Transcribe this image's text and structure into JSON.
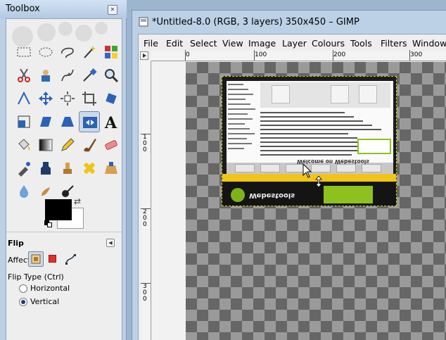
{
  "toolbox": {
    "title": "Toolbox",
    "close_icon": "close-icon",
    "tools": [
      "rect-select-icon",
      "ellipse-select-icon",
      "lasso-icon",
      "fuzzy-select-icon",
      "select-by-color-icon",
      "scissors-icon",
      "foreground-select-icon",
      "paths-icon",
      "color-picker-icon",
      "magnify-icon",
      "measure-icon",
      "move-icon",
      "align-icon",
      "crop-icon",
      "rotate-icon",
      "scale-icon",
      "shear-icon",
      "perspective-icon",
      "flip-icon",
      "text-icon",
      "bucket-fill-icon",
      "blend-icon",
      "pencil-icon",
      "paintbrush-icon",
      "eraser-icon",
      "airbrush-icon",
      "ink-icon",
      "clone-icon",
      "heal-icon",
      "perspective-clone-icon",
      "blur-icon",
      "smudge-icon",
      "dodge-burn-icon"
    ],
    "active_tool": "flip-icon",
    "fg_color": "#000000",
    "bg_color": "#ffffff"
  },
  "tool_options": {
    "title": "Flip",
    "affect_label": "Affect:",
    "flip_type_label": "Flip Type  (Ctrl)",
    "options": [
      "Horizontal",
      "Vertical"
    ],
    "selected": "Vertical"
  },
  "image_window": {
    "title": "*Untitled-8.0 (RGB, 3 layers) 350x450 – GIMP",
    "menus": [
      "File",
      "Edit",
      "Select",
      "View",
      "Image",
      "Layer",
      "Colours",
      "Tools",
      "Filters",
      "Windows"
    ],
    "hruler": [
      "0",
      "100",
      "200",
      "300"
    ],
    "vruler": [
      "1\n0\n0",
      "2\n0\n0",
      "3\n0\n0"
    ]
  },
  "layer_content": {
    "logo_text": "Webestools",
    "heading": "Welcome on Webestools"
  }
}
